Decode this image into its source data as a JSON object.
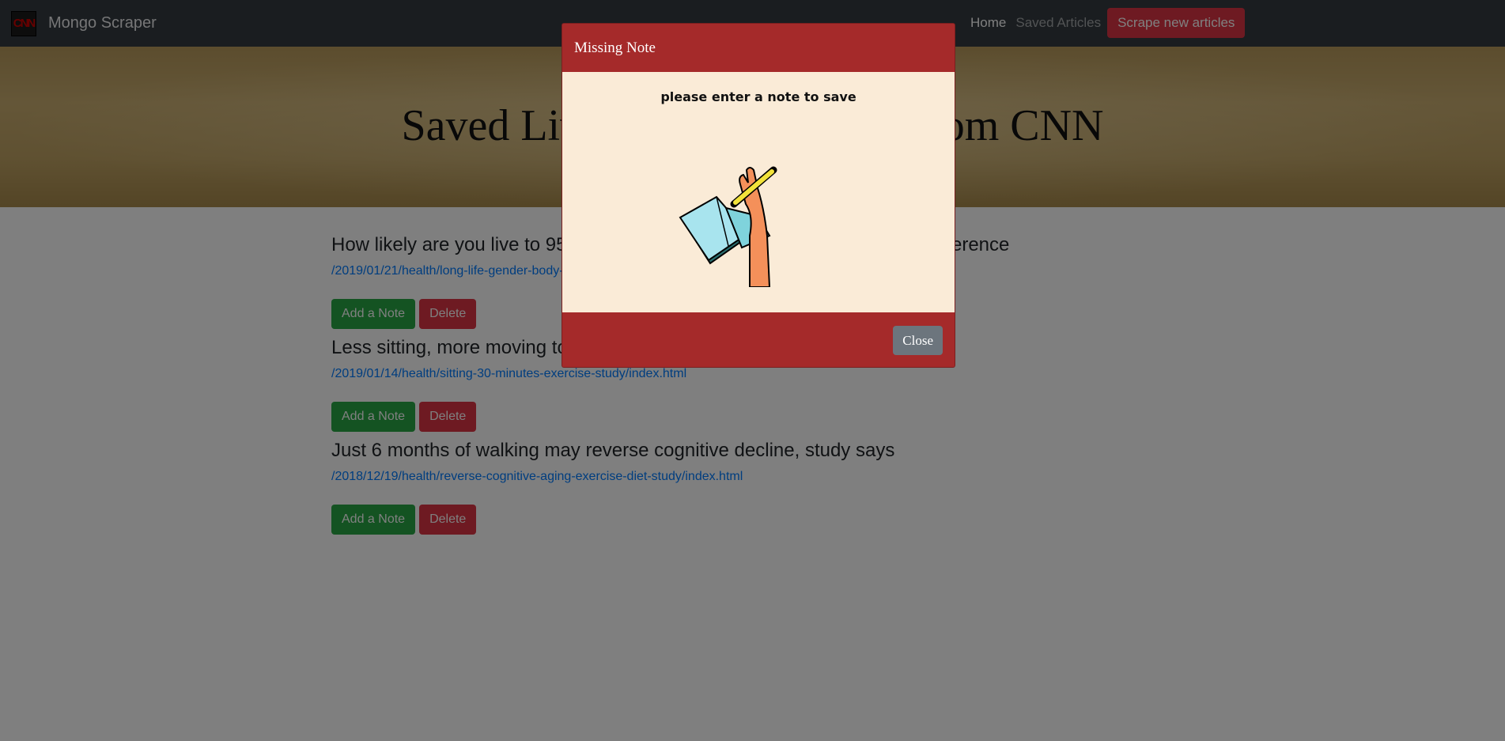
{
  "navbar": {
    "logo_text": "CNN",
    "brand": "Mongo Scraper",
    "home": "Home",
    "saved": "Saved Articles",
    "scrape": "Scrape new articles"
  },
  "jumbotron": {
    "title": "Saved Live Healthy Articles from CNN"
  },
  "articles": [
    {
      "title": "How likely are you live to 95? Gender, body size, and exercise make a difference",
      "link": "/2019/01/21/health/long-life-gender-body-size-exercise/index.html",
      "note_label": "Add a Note",
      "delete_label": "Delete"
    },
    {
      "title": "Less sitting, more moving to reduce early death risk, study says",
      "link": "/2019/01/14/health/sitting-30-minutes-exercise-study/index.html",
      "note_label": "Add a Note",
      "delete_label": "Delete"
    },
    {
      "title": "Just 6 months of walking may reverse cognitive decline, study says",
      "link": "/2018/12/19/health/reverse-cognitive-aging-exercise-diet-study/index.html",
      "note_label": "Add a Note",
      "delete_label": "Delete"
    }
  ],
  "modal": {
    "title": "Missing Note",
    "message": "please enter a note to save",
    "image_icon": "hand-writing-notebook-icon",
    "close_label": "Close"
  },
  "colors": {
    "navbar": "#343a40",
    "modal_header": "#a52a2a",
    "modal_body": "#faebd7",
    "success": "#28a745",
    "danger": "#dc3545",
    "secondary": "#6c757d",
    "link": "#007bff"
  }
}
